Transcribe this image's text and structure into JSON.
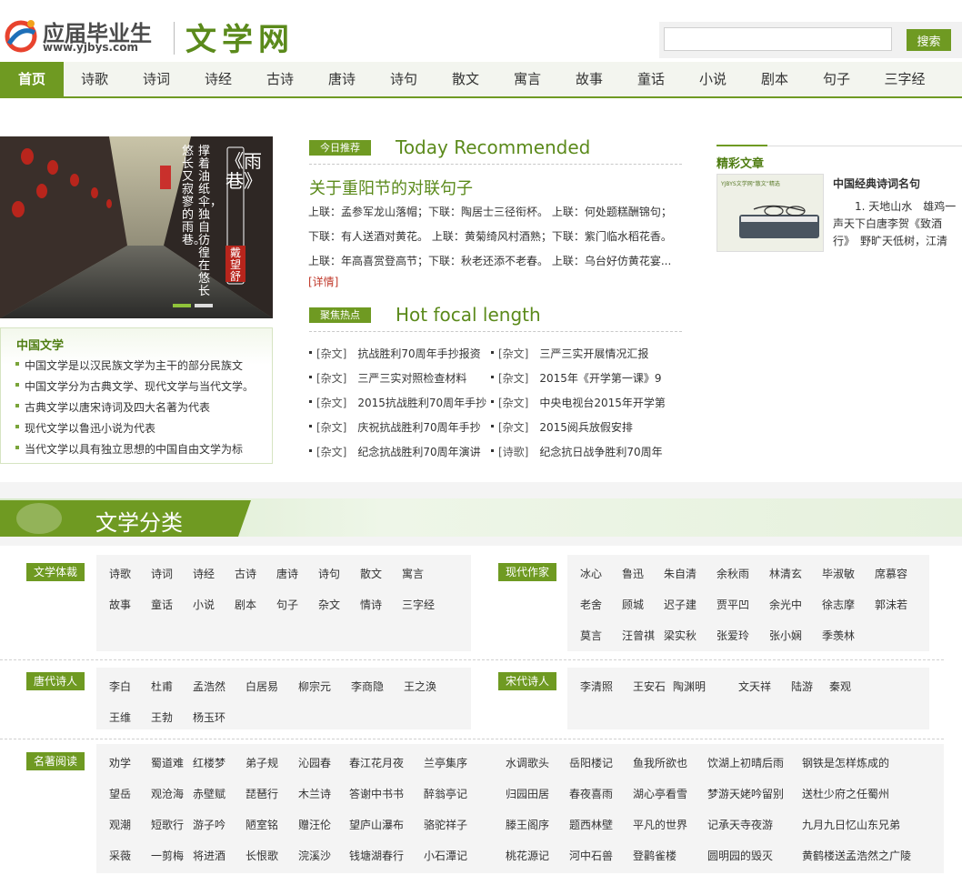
{
  "header": {
    "logo_cn": "应届毕业生",
    "logo_url": "www.yjbys.com",
    "site_name": "文学网",
    "search_placeholder": "",
    "search_button": "搜索"
  },
  "nav": [
    "首页",
    "诗歌",
    "诗词",
    "诗经",
    "古诗",
    "唐诗",
    "诗句",
    "散文",
    "寓言",
    "故事",
    "童话",
    "小说",
    "剧本",
    "句子",
    "三字经"
  ],
  "banner": {
    "title": "《雨巷》",
    "author": "戴望舒",
    "verse1": "撑着油纸伞，独自彷徨在悠长",
    "verse2": "悠长又寂寥的雨巷。"
  },
  "china_literature": {
    "title": "中国文学",
    "items": [
      "中国文学是以汉民族文学为主干的部分民族文",
      "中国文学分为古典文学、现代文学与当代文学。",
      "古典文学以唐宋诗词及四大名著为代表",
      "现代文学以鲁迅小说为代表",
      "当代文学以具有独立思想的中国自由文学为标"
    ]
  },
  "today": {
    "tag": "今日推荐",
    "title": "Today Recommended",
    "headline": "关于重阳节的对联句子",
    "lines": [
      "上联：孟参军龙山落帽；下联：陶居士三径衔杯。  上联：何处题糕酬锦句；",
      "下联：有人送酒对黄花。  上联：黄菊绮风村酒熟；下联：紫门临水稻花香。",
      "上联：年高喜赏登高节；下联：秋老还添不老春。  上联：乌台好仿黄花宴..."
    ],
    "detail": "[详情]"
  },
  "hot": {
    "tag": "聚焦热点",
    "title": "Hot focal length",
    "left": [
      {
        "cat": "[杂文]",
        "text": "抗战胜利70周年手抄报资"
      },
      {
        "cat": "[杂文]",
        "text": "三严三实对照检查材料"
      },
      {
        "cat": "[杂文]",
        "text": "2015抗战胜利70周年手抄"
      },
      {
        "cat": "[杂文]",
        "text": "庆祝抗战胜利70周年手抄"
      },
      {
        "cat": "[杂文]",
        "text": "纪念抗战胜利70周年演讲"
      }
    ],
    "right": [
      {
        "cat": "[杂文]",
        "text": "三严三实开展情况汇报"
      },
      {
        "cat": "[杂文]",
        "text": "2015年《开学第一课》9"
      },
      {
        "cat": "[杂文]",
        "text": "中央电视台2015年开学第"
      },
      {
        "cat": "[杂文]",
        "text": "2015阅兵放假安排"
      },
      {
        "cat": "[诗歌]",
        "text": "纪念抗日战争胜利70周年"
      }
    ]
  },
  "featured": {
    "title": "精彩文章",
    "thumb_text": "YJBYS文学网“散文”精选",
    "article_title": "中国经典诗词名句",
    "article_body": "1. 天地山水　雄鸡一声天下白唐李贺《致酒行》　野旷天低树，江清"
  },
  "categories": {
    "band_title": "文学分类",
    "genre": {
      "tag": "文学体裁",
      "items": [
        "诗歌",
        "诗词",
        "诗经",
        "古诗",
        "唐诗",
        "诗句",
        "散文",
        "寓言",
        "故事",
        "童话",
        "小说",
        "剧本",
        "句子",
        "杂文",
        "情诗",
        "三字经"
      ]
    },
    "modern": {
      "tag": "现代作家",
      "items": [
        "冰心",
        "鲁迅",
        "朱自清",
        "余秋雨",
        "林清玄",
        "毕淑敏",
        "席慕容",
        "老舍",
        "顾城",
        "迟子建",
        "贾平凹",
        "余光中",
        "徐志摩",
        "郭沫若",
        "莫言",
        "汪曾祺",
        "梁实秋",
        "张爱玲",
        "张小娴",
        "季羡林"
      ]
    },
    "tang": {
      "tag": "唐代诗人",
      "items": [
        "李白",
        "杜甫",
        "孟浩然",
        "白居易",
        "柳宗元",
        "李商隐",
        "王之涣",
        "王维",
        "王勃",
        "杨玉环"
      ]
    },
    "song": {
      "tag": "宋代诗人",
      "items": [
        "李清照",
        "王安石",
        "陶渊明",
        "文天祥",
        "陆游",
        "秦观"
      ]
    },
    "famous": {
      "tag": "名著阅读",
      "items": [
        "劝学",
        "蜀道难",
        "红楼梦",
        "弟子规",
        "沁园春",
        "春江花月夜",
        "兰亭集序",
        "水调歌头",
        "岳阳楼记",
        "鱼我所欲也",
        "饮湖上初晴后雨",
        "钢铁是怎样炼成的",
        "望岳",
        "观沧海",
        "赤壁赋",
        "琵琶行",
        "木兰诗",
        "答谢中书书",
        "醉翁亭记",
        "归园田居",
        "春夜喜雨",
        "湖心亭看雪",
        "梦游天姥吟留别",
        "送杜少府之任蜀州",
        "观潮",
        "短歌行",
        "游子吟",
        "陋室铭",
        "赠汪伦",
        "望庐山瀑布",
        "骆驼祥子",
        "滕王阁序",
        "题西林壁",
        "平凡的世界",
        "记承天寺夜游",
        "九月九日忆山东兄弟",
        "采薇",
        "一剪梅",
        "将进酒",
        "长恨歌",
        "浣溪沙",
        "钱塘湖春行",
        "小石潭记",
        "桃花源记",
        "河中石兽",
        "登鹳雀楼",
        "圆明园的毁灭",
        "黄鹤楼送孟浩然之广陵"
      ]
    }
  },
  "colors": {
    "accent": "#6f9a22",
    "link": "#5b8a1b",
    "detail": "#c0392b"
  }
}
